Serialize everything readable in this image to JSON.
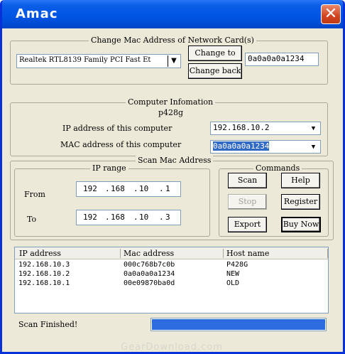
{
  "window": {
    "title": "Amac",
    "close_icon": "close-icon"
  },
  "change_mac": {
    "group_label": "Change Mac Address of Network Card(s)",
    "adapter_value": "Realtek RTL8139 Family PCI Fast Et",
    "change_to_label": "Change to",
    "change_back_label": "Change back",
    "mac_input_value": "0a0a0a0a1234"
  },
  "computer_info": {
    "group_label": "Computer Infomation",
    "hostname": "p428g",
    "ip_label": "IP address of this computer",
    "ip_value": "192.168.10.2",
    "mac_label": "MAC address of this computer",
    "mac_value": "0a0a0a0a1234"
  },
  "scan": {
    "group_label": "Scan Mac Address",
    "ip_range_label": "IP range",
    "from_label": "From",
    "to_label": "To",
    "from_ip": [
      "192",
      "168",
      "10",
      "1"
    ],
    "to_ip": [
      "192",
      "168",
      "10",
      "3"
    ],
    "commands_label": "Commands",
    "buttons": {
      "scan": "Scan",
      "help": "Help",
      "stop": "Stop",
      "register": "Register",
      "export": "Export",
      "buy_now": "Buy Now"
    }
  },
  "results": {
    "columns": [
      "IP address",
      "Mac address",
      "Host name"
    ],
    "rows": [
      [
        "192.168.10.3",
        "000c768b7c0b",
        "P428G"
      ],
      [
        "192.168.10.2",
        "0a0a0a0a1234",
        "NEW"
      ],
      [
        "192.168.10.1",
        "00e09870ba0d",
        "OLD"
      ]
    ]
  },
  "status": {
    "text": "Scan Finished!",
    "progress": 1.0
  },
  "watermark": "GearDownload.com"
}
